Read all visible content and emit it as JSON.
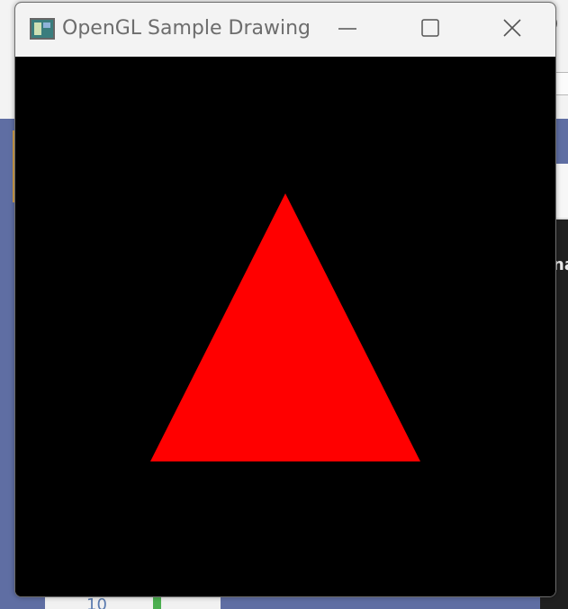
{
  "background": {
    "topright_text": ")",
    "right_panel_text": "na",
    "bottom_number": "10"
  },
  "window": {
    "title": "OpenGL Sample Drawing",
    "controls": {
      "minimize": "minimize-icon",
      "maximize": "maximize-icon",
      "close": "close-icon"
    }
  },
  "canvas": {
    "background_color": "#000000",
    "shape": "triangle",
    "fill_color": "#ff0000"
  }
}
